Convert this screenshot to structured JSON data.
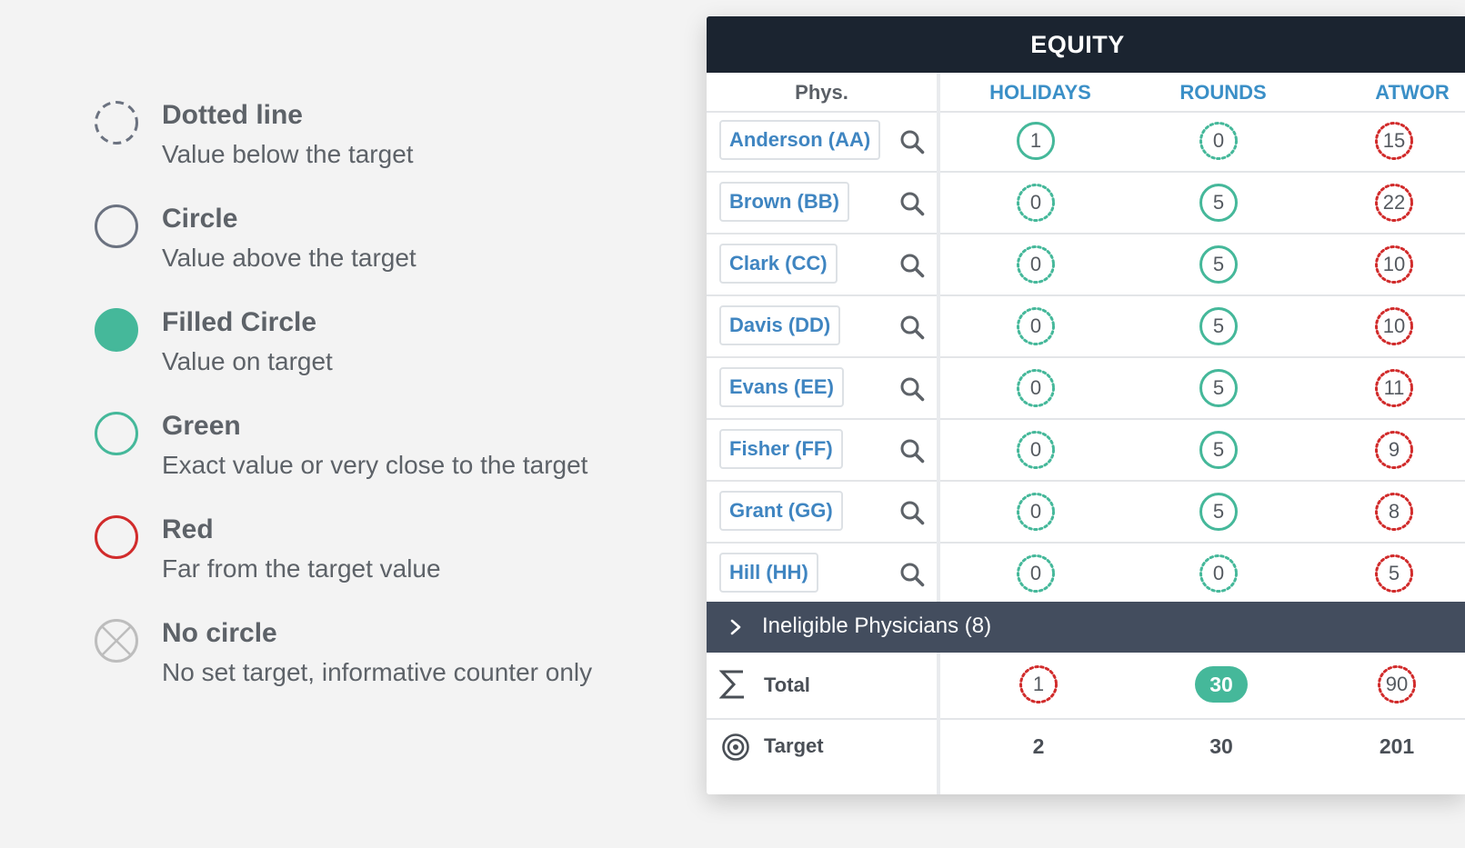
{
  "legend": [
    {
      "style": "dotted",
      "color": "#6b7280",
      "title": "Dotted line",
      "desc": "Value below the target"
    },
    {
      "style": "circle",
      "color": "#6b7280",
      "title": "Circle",
      "desc": "Value above the target"
    },
    {
      "style": "filled",
      "color": "#45b89a",
      "title": "Filled Circle",
      "desc": "Value on target"
    },
    {
      "style": "circle",
      "color": "#45b89a",
      "title": "Green",
      "desc": "Exact value or very close to the target"
    },
    {
      "style": "circle",
      "color": "#d12b2b",
      "title": "Red",
      "desc": "Far from the target value"
    },
    {
      "style": "none",
      "color": "#bdbdbd",
      "title": "No circle",
      "desc": "No set target, informative counter only"
    }
  ],
  "panel": {
    "title": "EQUITY",
    "columns": {
      "phys": "Phys.",
      "holidays": "HOLIDAYS",
      "rounds": "ROUNDS",
      "atwork": "ATWOR"
    },
    "rows": [
      {
        "name": "Anderson (AA)",
        "holidays": {
          "value": "1",
          "style": "solid",
          "color": "green"
        },
        "rounds": {
          "value": "0",
          "style": "dotted",
          "color": "green"
        },
        "atwork": {
          "value": "15",
          "style": "dotted",
          "color": "red"
        }
      },
      {
        "name": "Brown (BB)",
        "holidays": {
          "value": "0",
          "style": "dotted",
          "color": "green"
        },
        "rounds": {
          "value": "5",
          "style": "solid",
          "color": "green"
        },
        "atwork": {
          "value": "22",
          "style": "dotted",
          "color": "red"
        }
      },
      {
        "name": "Clark (CC)",
        "holidays": {
          "value": "0",
          "style": "dotted",
          "color": "green"
        },
        "rounds": {
          "value": "5",
          "style": "solid",
          "color": "green"
        },
        "atwork": {
          "value": "10",
          "style": "dotted",
          "color": "red"
        }
      },
      {
        "name": "Davis (DD)",
        "holidays": {
          "value": "0",
          "style": "dotted",
          "color": "green"
        },
        "rounds": {
          "value": "5",
          "style": "solid",
          "color": "green"
        },
        "atwork": {
          "value": "10",
          "style": "dotted",
          "color": "red"
        }
      },
      {
        "name": "Evans (EE)",
        "holidays": {
          "value": "0",
          "style": "dotted",
          "color": "green"
        },
        "rounds": {
          "value": "5",
          "style": "solid",
          "color": "green"
        },
        "atwork": {
          "value": "11",
          "style": "dotted",
          "color": "red"
        }
      },
      {
        "name": "Fisher (FF)",
        "holidays": {
          "value": "0",
          "style": "dotted",
          "color": "green"
        },
        "rounds": {
          "value": "5",
          "style": "solid",
          "color": "green"
        },
        "atwork": {
          "value": "9",
          "style": "dotted",
          "color": "red"
        }
      },
      {
        "name": "Grant (GG)",
        "holidays": {
          "value": "0",
          "style": "dotted",
          "color": "green"
        },
        "rounds": {
          "value": "5",
          "style": "solid",
          "color": "green"
        },
        "atwork": {
          "value": "8",
          "style": "dotted",
          "color": "red"
        }
      },
      {
        "name": "Hill (HH)",
        "holidays": {
          "value": "0",
          "style": "dotted",
          "color": "green"
        },
        "rounds": {
          "value": "0",
          "style": "dotted",
          "color": "green"
        },
        "atwork": {
          "value": "5",
          "style": "dotted",
          "color": "red"
        }
      }
    ],
    "ineligible_label": "Ineligible Physicians (8)",
    "total": {
      "label": "Total",
      "holidays": {
        "value": "1",
        "style": "dotted",
        "color": "red"
      },
      "rounds": {
        "value": "30",
        "style": "filled",
        "color": "green"
      },
      "atwork": {
        "value": "90",
        "style": "dotted",
        "color": "red"
      }
    },
    "target": {
      "label": "Target",
      "holidays": "2",
      "rounds": "30",
      "atwork": "201"
    }
  },
  "colors": {
    "green": "#45b89a",
    "red": "#d12b2b",
    "header_bg": "#1b2430",
    "ineligible_bg": "#434d5e",
    "link": "#3f85c1",
    "col_head": "#3a8fc7"
  },
  "icons": {
    "row_action": "search-icon",
    "expand": "chevron-right-icon",
    "total": "sigma-icon",
    "target": "target-icon",
    "no_circle": "circle-x-icon"
  }
}
